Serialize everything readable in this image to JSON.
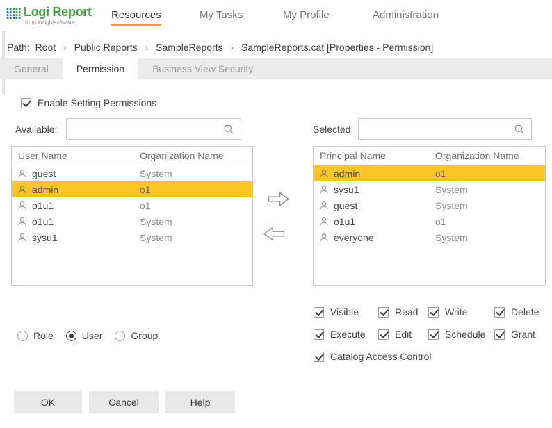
{
  "brand": {
    "name": "Logi Report",
    "tagline": "from insightsoftware"
  },
  "nav": {
    "items": [
      {
        "label": "Resources",
        "active": true
      },
      {
        "label": "My Tasks",
        "active": false
      },
      {
        "label": "My Profile",
        "active": false
      },
      {
        "label": "Administration",
        "active": false
      }
    ]
  },
  "breadcrumb": {
    "prefix": "Path:",
    "separator": "›",
    "segments": [
      "Root",
      "Public Reports",
      "SampleReports",
      "SampleReports.cat [Properties - Permission]"
    ]
  },
  "tabs": [
    {
      "label": "General",
      "active": false
    },
    {
      "label": "Permission",
      "active": true
    },
    {
      "label": "Business View Security",
      "active": false
    }
  ],
  "permission": {
    "enable_label": "Enable Setting Permissions",
    "enable_checked": true,
    "available": {
      "label": "Available:",
      "search_value": "",
      "columns": [
        "User Name",
        "Organization Name"
      ],
      "rows": [
        {
          "name": "guest",
          "org": "System",
          "selected": false
        },
        {
          "name": "admin",
          "org": "o1",
          "selected": true
        },
        {
          "name": "o1u1",
          "org": "o1",
          "selected": false
        },
        {
          "name": "o1u1",
          "org": "System",
          "selected": false
        },
        {
          "name": "sysu1",
          "org": "System",
          "selected": false
        }
      ]
    },
    "selected": {
      "label": "Selected:",
      "search_value": "",
      "columns": [
        "Principal Name",
        "Organization Name"
      ],
      "rows": [
        {
          "name": "admin",
          "org": "o1",
          "selected": true
        },
        {
          "name": "sysu1",
          "org": "System",
          "selected": false
        },
        {
          "name": "guest",
          "org": "System",
          "selected": false
        },
        {
          "name": "o1u1",
          "org": "o1",
          "selected": false
        },
        {
          "name": "everyone",
          "org": "System",
          "selected": false
        }
      ]
    },
    "principal_types": [
      {
        "label": "Role",
        "checked": false
      },
      {
        "label": "User",
        "checked": true
      },
      {
        "label": "Group",
        "checked": false
      }
    ],
    "rights": [
      {
        "label": "Visible",
        "checked": true
      },
      {
        "label": "Read",
        "checked": true
      },
      {
        "label": "Write",
        "checked": true
      },
      {
        "label": "Delete",
        "checked": true
      },
      {
        "label": "Execute",
        "checked": true
      },
      {
        "label": "Edit",
        "checked": true
      },
      {
        "label": "Schedule",
        "checked": true
      },
      {
        "label": "Grant",
        "checked": true
      },
      {
        "label": "Catalog Access Control",
        "checked": true
      }
    ],
    "footer_buttons": [
      {
        "label": "OK"
      },
      {
        "label": "Cancel"
      },
      {
        "label": "Help"
      }
    ]
  },
  "icons": {
    "search": "magnifier",
    "user": "person-outline",
    "move_right": "block-arrow-right",
    "move_left": "block-arrow-left"
  },
  "colors": {
    "brand_green": "#3fa142",
    "nav_underline": "#f0a030",
    "row_highlight": "#f9c623",
    "tabbar_bg": "#ececec",
    "button_bg": "#e8e8e8"
  }
}
